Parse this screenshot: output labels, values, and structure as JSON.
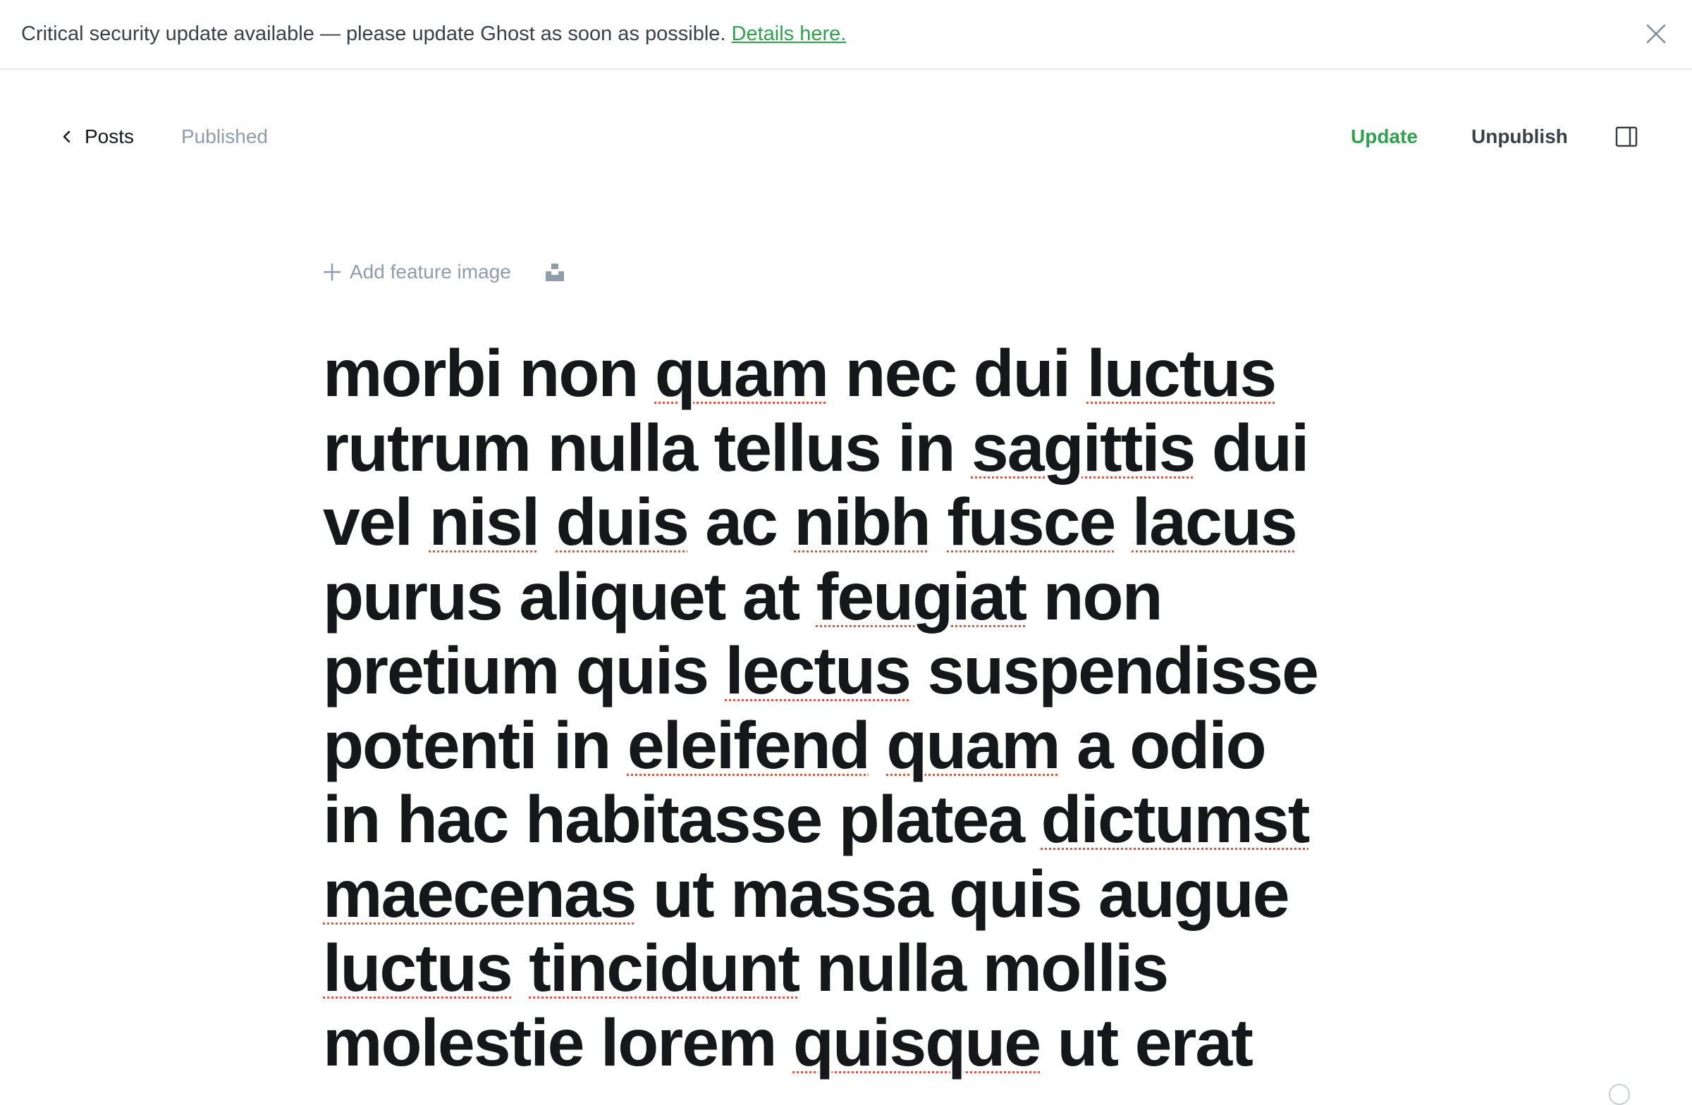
{
  "banner": {
    "message": "Critical security update available — please update Ghost as soon as possible.",
    "link_label": "Details here.",
    "close_icon": "close-icon"
  },
  "header": {
    "back_label": "Posts",
    "back_icon": "chevron-left-icon",
    "status": "Published",
    "update_label": "Update",
    "unpublish_label": "Unpublish",
    "sidebar_icon": "sidebar-toggle-icon"
  },
  "feature_image": {
    "add_label": "Add feature image",
    "plus_icon": "plus-icon",
    "unsplash_icon": "unsplash-icon"
  },
  "post": {
    "title_lines": [
      [
        {
          "t": "morbi non "
        },
        {
          "t": "quam",
          "s": true
        },
        {
          "t": " nec dui "
        },
        {
          "t": "luctus",
          "s": true
        }
      ],
      [
        {
          "t": "rutrum nulla tellus in "
        },
        {
          "t": "sagittis",
          "s": true
        },
        {
          "t": " dui"
        }
      ],
      [
        {
          "t": "vel "
        },
        {
          "t": "nisl",
          "s": true
        },
        {
          "t": " "
        },
        {
          "t": "duis",
          "s": true
        },
        {
          "t": " ac "
        },
        {
          "t": "nibh",
          "s": true
        },
        {
          "t": " "
        },
        {
          "t": "fusce",
          "s": true
        },
        {
          "t": " "
        },
        {
          "t": "lacus",
          "s": true
        }
      ],
      [
        {
          "t": "purus aliquet at "
        },
        {
          "t": "feugiat",
          "s": true
        },
        {
          "t": " non"
        }
      ],
      [
        {
          "t": "pretium quis "
        },
        {
          "t": "lectus",
          "s": true
        },
        {
          "t": " suspendisse"
        }
      ],
      [
        {
          "t": "potenti in "
        },
        {
          "t": "eleifend",
          "s": true
        },
        {
          "t": " "
        },
        {
          "t": "quam",
          "s": true
        },
        {
          "t": " a odio"
        }
      ],
      [
        {
          "t": "in hac habitasse platea "
        },
        {
          "t": "dictumst",
          "s": true
        }
      ],
      [
        {
          "t": "maecenas",
          "s": true
        },
        {
          "t": " ut massa quis augue"
        }
      ],
      [
        {
          "t": "luctus",
          "s": true
        },
        {
          "t": " "
        },
        {
          "t": "tincidunt",
          "s": true
        },
        {
          "t": " nulla mollis"
        }
      ],
      [
        {
          "t": "molestie lorem "
        },
        {
          "t": "quisque",
          "s": true
        },
        {
          "t": " ut erat"
        }
      ]
    ]
  },
  "colors": {
    "accent_green": "#30a14e",
    "muted_text": "#8e9cac",
    "spellcheck": "#e25440"
  }
}
